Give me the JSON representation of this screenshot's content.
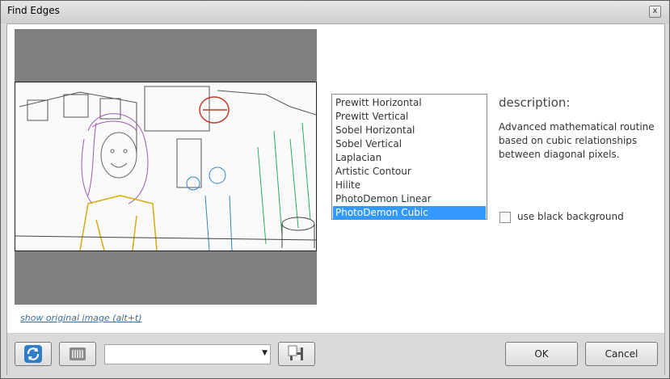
{
  "window": {
    "title": "Find Edges",
    "close_glyph": "x"
  },
  "preview": {
    "show_original_link": "show original image (alt+t)"
  },
  "filters": {
    "items": [
      "Prewitt Horizontal",
      "Prewitt Vertical",
      "Sobel Horizontal",
      "Sobel Vertical",
      "Laplacian",
      "Artistic Contour",
      "Hilite",
      "PhotoDemon Linear",
      "PhotoDemon Cubic"
    ],
    "selected": "PhotoDemon Cubic"
  },
  "description": {
    "title": "description:",
    "text": "Advanced mathematical routine based on cubic relationships between diagonal pixels."
  },
  "options": {
    "black_background_label": "use black background",
    "black_background_checked": false
  },
  "bottom": {
    "reset_icon": "refresh-icon",
    "random_icon": "randomize-icon",
    "preset_value": "",
    "save_icon": "save-preset-icon",
    "ok_label": "OK",
    "cancel_label": "Cancel"
  },
  "colors": {
    "selection": "#3399ff",
    "link": "#3a6ea5",
    "preview_bg": "#7f7f7f"
  }
}
